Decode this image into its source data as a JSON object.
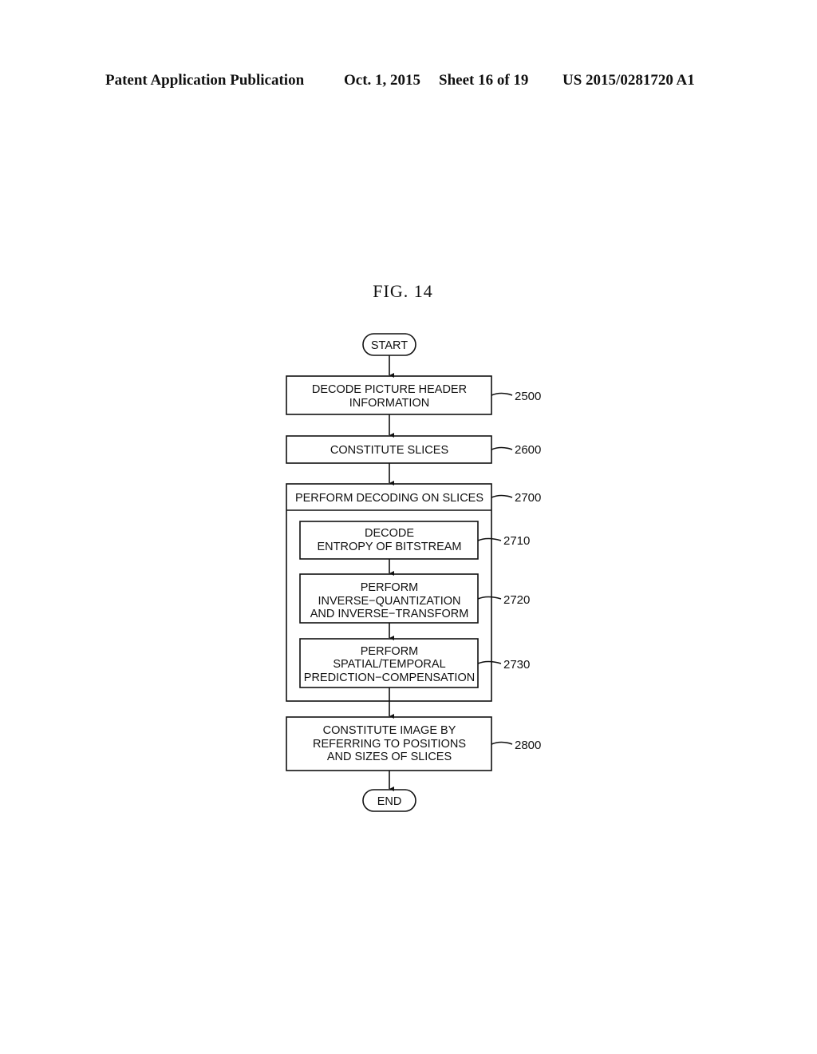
{
  "header": {
    "publication": "Patent Application Publication",
    "date": "Oct. 1, 2015",
    "sheet": "Sheet 16 of 19",
    "number": "US 2015/0281720 A1"
  },
  "figure": {
    "title": "FIG.  14",
    "start_label": "START",
    "end_label": "END",
    "steps": [
      {
        "ref": "2500",
        "lines": [
          "DECODE PICTURE HEADER",
          "INFORMATION"
        ]
      },
      {
        "ref": "2600",
        "lines": [
          "CONSTITUTE SLICES"
        ]
      },
      {
        "ref": "2700",
        "lines": [
          "PERFORM DECODING ON SLICES"
        ],
        "substeps": [
          {
            "ref": "2710",
            "lines": [
              "DECODE",
              "ENTROPY OF BITSTREAM"
            ]
          },
          {
            "ref": "2720",
            "lines": [
              "PERFORM",
              "INVERSE−QUANTIZATION",
              "AND INVERSE−TRANSFORM"
            ]
          },
          {
            "ref": "2730",
            "lines": [
              "PERFORM",
              "SPATIAL/TEMPORAL",
              "PREDICTION−COMPENSATION"
            ]
          }
        ]
      },
      {
        "ref": "2800",
        "lines": [
          "CONSTITUTE IMAGE BY",
          "REFERRING TO POSITIONS",
          "AND SIZES OF SLICES"
        ]
      }
    ]
  }
}
